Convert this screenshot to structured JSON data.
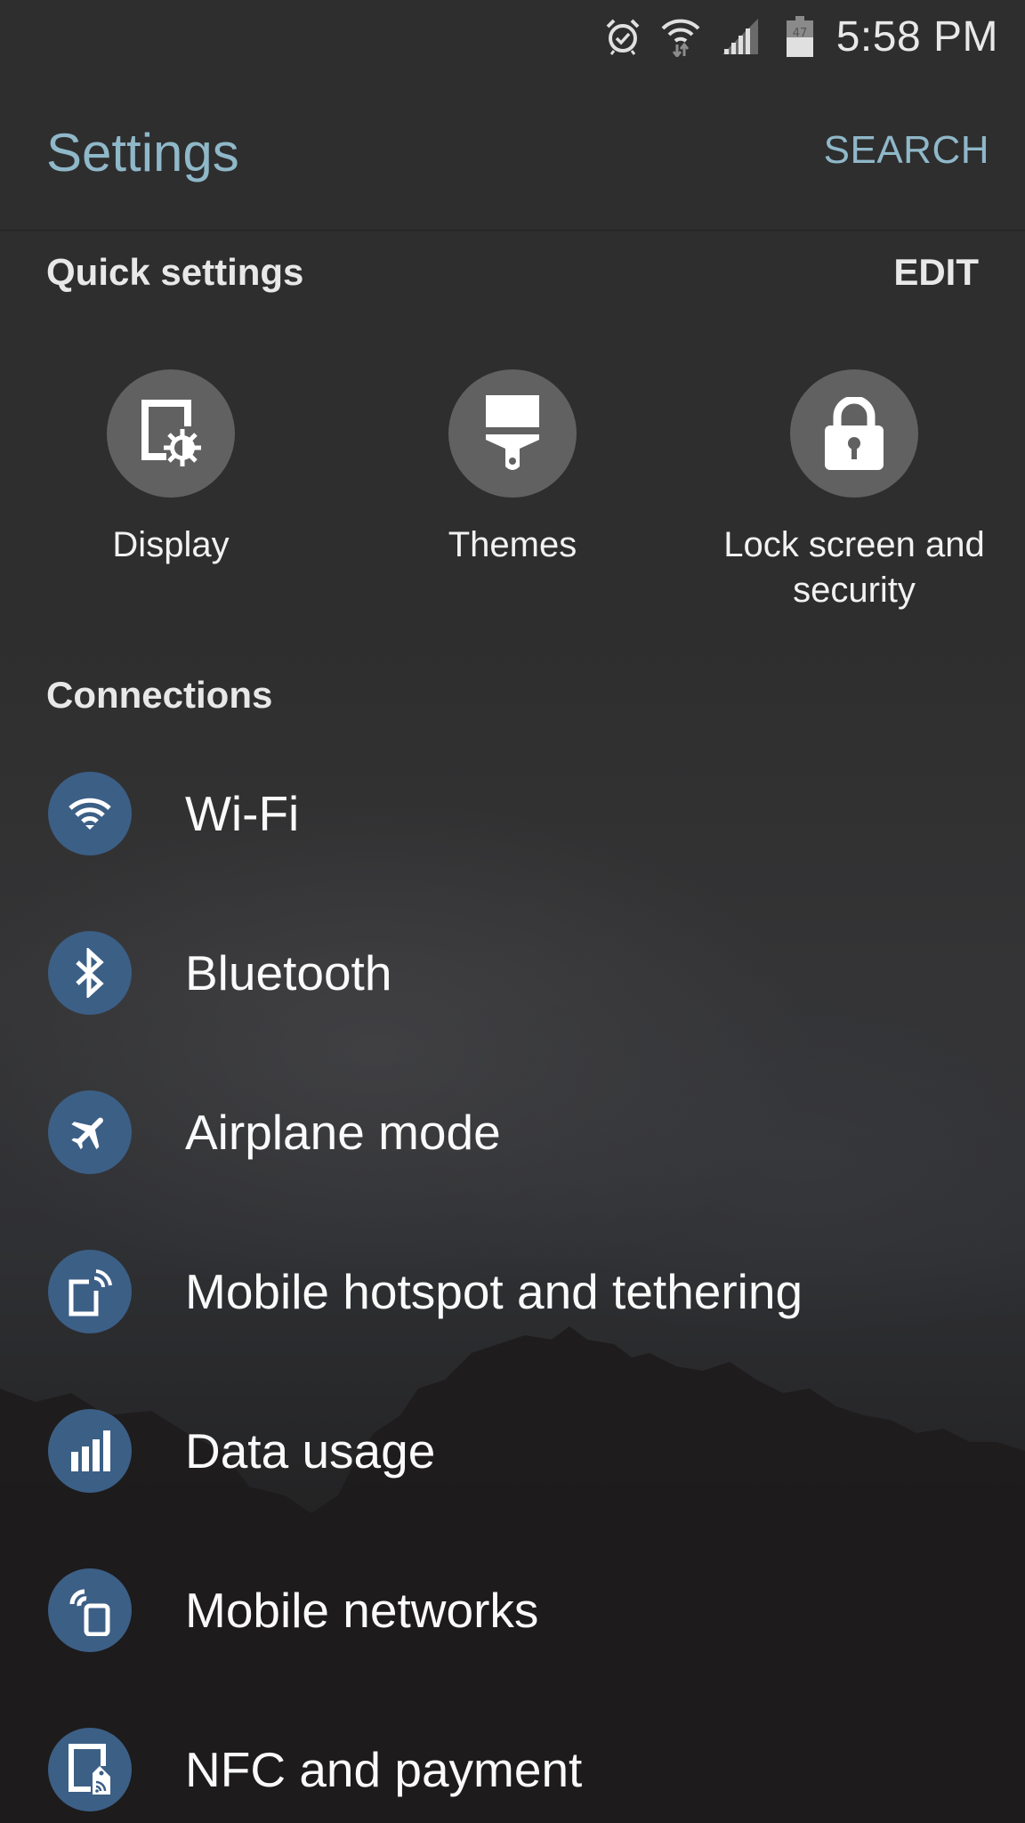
{
  "status_bar": {
    "icons": [
      "alarm-icon",
      "wifi-data-icon",
      "cell-signal-icon",
      "battery-icon"
    ],
    "battery_level": "47",
    "time": "5:58 PM"
  },
  "header": {
    "title": "Settings",
    "search_label": "SEARCH"
  },
  "quick_settings": {
    "title": "Quick settings",
    "edit_label": "EDIT",
    "items": [
      {
        "label": "Display",
        "icon": "display-settings-icon"
      },
      {
        "label": "Themes",
        "icon": "paint-brush-icon"
      },
      {
        "label": "Lock screen and security",
        "icon": "lock-icon"
      }
    ]
  },
  "connections": {
    "title": "Connections",
    "items": [
      {
        "label": "Wi-Fi",
        "icon": "wifi-icon"
      },
      {
        "label": "Bluetooth",
        "icon": "bluetooth-icon"
      },
      {
        "label": "Airplane mode",
        "icon": "airplane-icon"
      },
      {
        "label": "Mobile hotspot and tethering",
        "icon": "hotspot-icon"
      },
      {
        "label": "Data usage",
        "icon": "data-usage-icon"
      },
      {
        "label": "Mobile networks",
        "icon": "mobile-networks-icon"
      },
      {
        "label": "NFC and payment",
        "icon": "nfc-payment-icon"
      }
    ]
  },
  "colors": {
    "accent": "#8fb8c9",
    "connection_icon_bg": "#3c5f86",
    "quick_icon_bg": "#616161"
  }
}
